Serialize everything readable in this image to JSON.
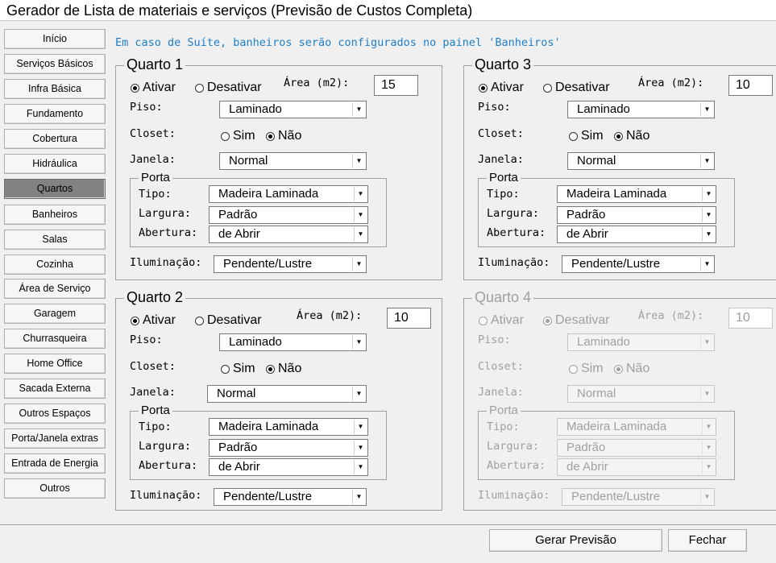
{
  "window": {
    "title": "Gerador de Lista de materiais e serviços (Previsão de Custos Completa)"
  },
  "nav": [
    {
      "label": "Início"
    },
    {
      "label": "Serviços Básicos"
    },
    {
      "label": "Infra Básica"
    },
    {
      "label": "Fundamento"
    },
    {
      "label": "Cobertura"
    },
    {
      "label": "Hidráulica"
    },
    {
      "label": "Quartos",
      "active": true
    },
    {
      "label": "Banheiros"
    },
    {
      "label": "Salas"
    },
    {
      "label": "Cozinha"
    },
    {
      "label": "Área de Serviço"
    },
    {
      "label": "Garagem"
    },
    {
      "label": "Churrasqueira"
    },
    {
      "label": "Home Office"
    },
    {
      "label": "Sacada Externa"
    },
    {
      "label": "Outros Espaços"
    },
    {
      "label": "Porta/Janela extras"
    },
    {
      "label": "Entrada de Energia"
    },
    {
      "label": "Outros"
    }
  ],
  "info_text": "Em caso de Suíte, banheiros serão configurados no painel 'Banheiros'",
  "labels": {
    "ativar": "Ativar",
    "desativar": "Desativar",
    "area": "Área (m2):",
    "piso": "Piso:",
    "closet": "Closet:",
    "sim": "Sim",
    "nao": "Não",
    "janela": "Janela:",
    "porta": "Porta",
    "tipo": "Tipo:",
    "largura": "Largura:",
    "abertura": "Abertura:",
    "iluminacao": "Iluminação:"
  },
  "rooms": [
    {
      "title": "Quarto 1",
      "active": true,
      "area": "15",
      "piso": "Laminado",
      "closet": "Não",
      "janela": "Normal",
      "porta_tipo": "Madeira Laminada",
      "porta_largura": "Padrão",
      "porta_abertura": "de Abrir",
      "iluminacao": "Pendente/Lustre"
    },
    {
      "title": "Quarto 2",
      "active": true,
      "area": "10",
      "piso": "Laminado",
      "closet": "Não",
      "janela": "Normal",
      "porta_tipo": "Madeira Laminada",
      "porta_largura": "Padrão",
      "porta_abertura": "de Abrir",
      "iluminacao": "Pendente/Lustre"
    },
    {
      "title": "Quarto 3",
      "active": true,
      "area": "10",
      "piso": "Laminado",
      "closet": "Não",
      "janela": "Normal",
      "porta_tipo": "Madeira Laminada",
      "porta_largura": "Padrão",
      "porta_abertura": "de Abrir",
      "iluminacao": "Pendente/Lustre"
    },
    {
      "title": "Quarto 4",
      "active": false,
      "area": "10",
      "piso": "Laminado",
      "closet": "Não",
      "janela": "Normal",
      "porta_tipo": "Madeira Laminada",
      "porta_largura": "Padrão",
      "porta_abertura": "de Abrir",
      "iluminacao": "Pendente/Lustre"
    }
  ],
  "actions": {
    "generate": "Gerar Previsão",
    "close": "Fechar"
  },
  "colors": {
    "info": "#1d7fcc",
    "active_nav": "#828282",
    "disabled_text": "#a0a0a0"
  }
}
